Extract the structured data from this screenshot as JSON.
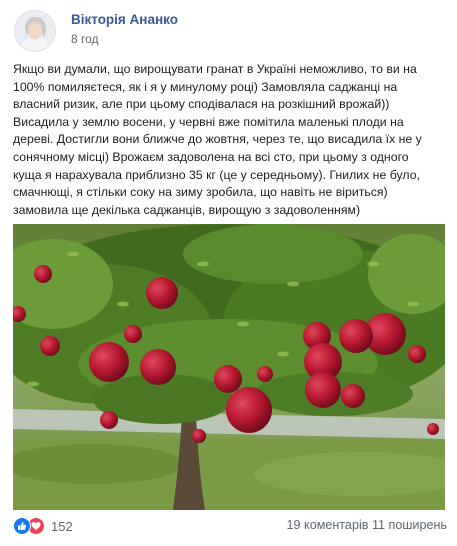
{
  "post": {
    "author": "Вікторія Ананко",
    "time": "8 год",
    "text": "Якщо ви думали, що вирощувати гранат в Україні неможливо, то ви на\n100% помиляєтеся, як і я у минулому році) Замовляла саджанці на\nвласний ризик, але при цьому сподівалася на розкішний врожай))\nВисадила у землю восени, у червні  вже помітила маленькі плоди на\nдереві. Достигли вони ближче до жовтня, через те, що висадила їх не у\nсонячному місці) Врожаєм задоволена на всі сто, при цьому з одного\nкуща  я нарахувала приблизно 35 кг (це у середньому). Гнилих не було,\nсмачнющі, я стільки соку на зиму зробила, що навіть не віриться)\nзамовила ще декілька саджанців, вирощую з задоволенням)"
  },
  "footer": {
    "reaction_count": "152",
    "comments": "19 коментарів",
    "shares": "11 поширень"
  },
  "icons": {
    "like": "like-icon",
    "love": "love-icon"
  },
  "colors": {
    "author_link": "#385898",
    "like": "#1877f2",
    "love": "#f33e58",
    "fruit": "#b5172f"
  }
}
